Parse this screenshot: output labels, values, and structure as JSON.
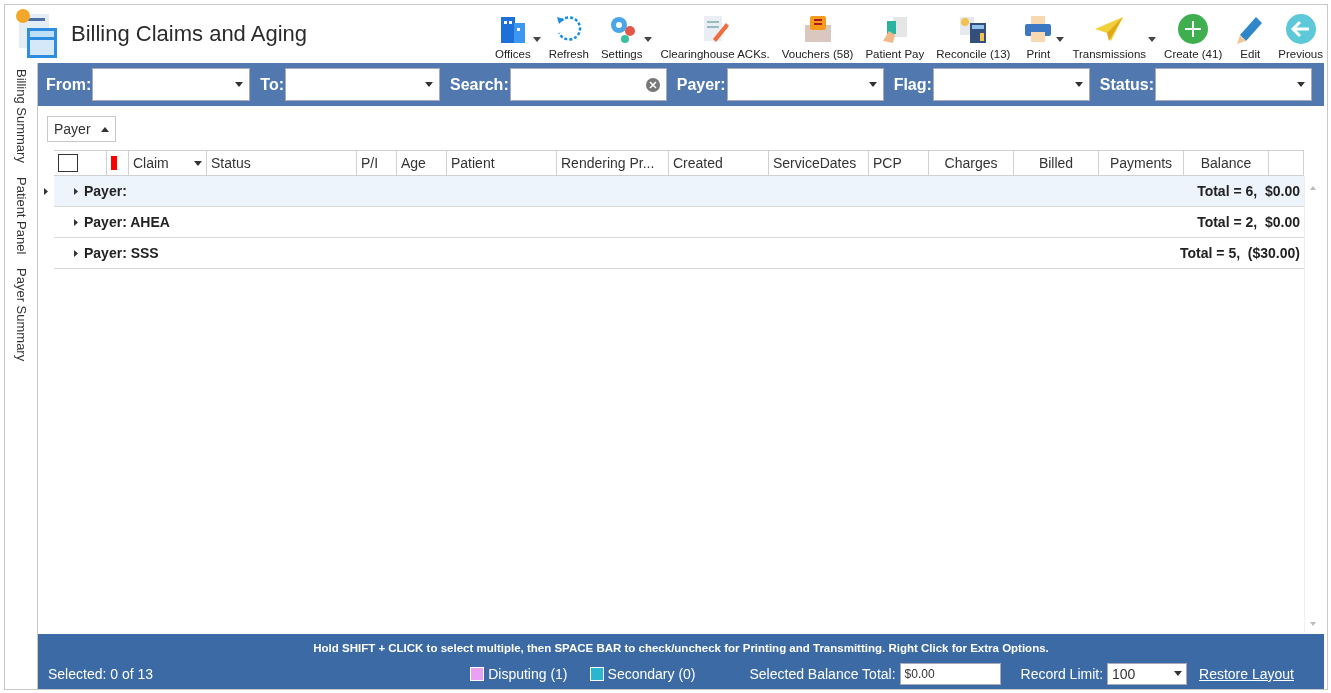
{
  "app": {
    "title": "Billing Claims and Aging"
  },
  "toolbar": [
    {
      "kind": "offices",
      "label": "Offices",
      "dropdown": true
    },
    {
      "kind": "refresh",
      "label": "Refresh",
      "dropdown": false
    },
    {
      "kind": "settings",
      "label": "Settings",
      "dropdown": true
    },
    {
      "kind": "document",
      "label": "Clearinghouse ACKs.",
      "dropdown": false
    },
    {
      "kind": "voucher",
      "label": "Vouchers (58)",
      "dropdown": false
    },
    {
      "kind": "pay",
      "label": "Patient Pay",
      "dropdown": false
    },
    {
      "kind": "calculator",
      "label": "Reconcile (13)",
      "dropdown": false
    },
    {
      "kind": "print",
      "label": "Print",
      "dropdown": true
    },
    {
      "kind": "plane",
      "label": "Transmissions",
      "dropdown": true
    },
    {
      "kind": "create",
      "label": "Create (41)",
      "dropdown": false
    },
    {
      "kind": "edit",
      "label": "Edit",
      "dropdown": false
    },
    {
      "kind": "back",
      "label": "Previous",
      "dropdown": false
    }
  ],
  "side_tabs": [
    {
      "label": "Billing Summary"
    },
    {
      "label": "Patient Panel"
    },
    {
      "label": "Payer Summary"
    }
  ],
  "filters": [
    {
      "label": "From:",
      "kind": "dropdown"
    },
    {
      "label": "To:",
      "kind": "dropdown"
    },
    {
      "label": "Search:",
      "kind": "search"
    },
    {
      "label": "Payer:",
      "kind": "dropdown"
    },
    {
      "label": "Flag:",
      "kind": "dropdown"
    },
    {
      "label": "Status:",
      "kind": "dropdown"
    }
  ],
  "group_by": {
    "label": "Payer"
  },
  "columns": [
    {
      "kind": "checkbox",
      "checked": false
    },
    {
      "kind": "flag"
    },
    {
      "kind": "sort",
      "label": "Claim"
    },
    {
      "kind": "text",
      "label": "Status"
    },
    {
      "kind": "text",
      "label": "P/I"
    },
    {
      "kind": "text",
      "label": "Age"
    },
    {
      "kind": "text",
      "label": "Patient"
    },
    {
      "kind": "text",
      "label": "Rendering Pr..."
    },
    {
      "kind": "text",
      "label": "Created"
    },
    {
      "kind": "text",
      "label": "ServiceDates"
    },
    {
      "kind": "text",
      "label": "PCP"
    },
    {
      "kind": "center",
      "label": "Charges"
    },
    {
      "kind": "center",
      "label": "Billed"
    },
    {
      "kind": "center",
      "label": "Payments"
    },
    {
      "kind": "center",
      "label": "Balance"
    }
  ],
  "groups": [
    {
      "label": "Payer:",
      "total": "Total = 6,  $0.00",
      "selected": true
    },
    {
      "label": "Payer: AHEA",
      "total": "Total = 2,  $0.00",
      "selected": false
    },
    {
      "label": "Payer: SSS",
      "total": "Total = 5,  ($30.00)",
      "selected": false
    }
  ],
  "footer": {
    "hint": "Hold SHIFT + CLICK to select multiple, then SPACE BAR to check/uncheck for Printing and Transmitting. Right Click for Extra Options.",
    "selected": "Selected: 0 of 13",
    "legend": [
      {
        "label": "Disputing",
        "count": "(1)",
        "color": "#e9a0f5"
      },
      {
        "label": "Secondary",
        "count": "(0)",
        "color": "#29b6cf"
      }
    ],
    "balance_label": "Selected Balance Total:",
    "balance_value": "$0.00",
    "limit_label": "Record Limit:",
    "limit_value": "100",
    "restore": "Restore Layout"
  }
}
